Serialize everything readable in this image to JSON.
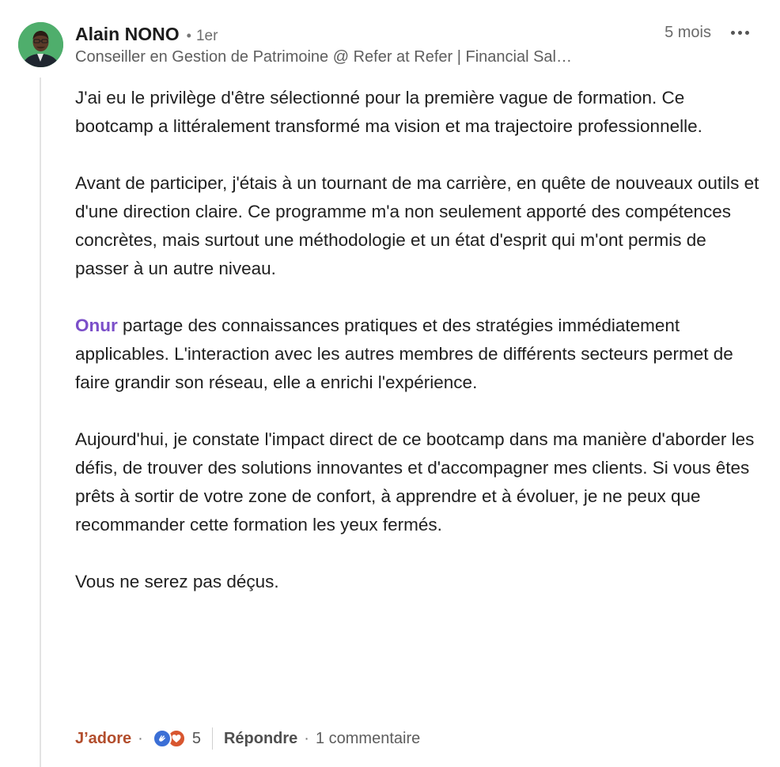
{
  "comment": {
    "author": {
      "name": "Alain NONO",
      "connection_separator": "•",
      "connection_degree": "1er",
      "headline": "Conseiller en Gestion de Patrimoine @ Refer at Refer | Financial Sal…"
    },
    "timestamp": "5 mois",
    "more_icon": "more-horizontal-icon",
    "paragraphs": [
      "J'ai eu le privilège d'être sélectionné pour la première vague de formation. Ce bootcamp a littéralement transformé ma vision et ma trajectoire professionnelle.",
      "Avant de participer, j'étais à un tournant de ma carrière, en quête de nouveaux outils et d'une direction claire. Ce programme m'a non seulement apporté des compétences concrètes, mais surtout une méthodologie et un état d'esprit qui m'ont permis de passer à un autre niveau.",
      {
        "mention": "Onur",
        "text": " partage des connaissances pratiques et des stratégies immédiatement applicables. L'interaction avec les autres membres de différents secteurs permet de faire grandir son réseau, elle a enrichi l'expérience."
      },
      "Aujourd'hui, je constate l'impact direct de ce bootcamp dans ma manière d'aborder les défis, de trouver des solutions innovantes et d'accompagner mes clients. Si vous êtes prêts à sortir de votre zone de confort, à apprendre et à évoluer, je ne peux que recommander cette formation les yeux fermés.",
      "Vous ne serez pas déçus."
    ],
    "actions": {
      "reaction_label": "J’adore",
      "dot": "·",
      "reaction_icons": [
        "clapping-hands-icon",
        "heart-icon"
      ],
      "reaction_count": "5",
      "reply_label": "Répondre",
      "reply_count": "1 commentaire"
    },
    "colors": {
      "mention": "#7b4fc9",
      "reaction_active": "#b24d2c",
      "like_badge": "#3b6fd6",
      "love_badge": "#d8562f"
    }
  }
}
